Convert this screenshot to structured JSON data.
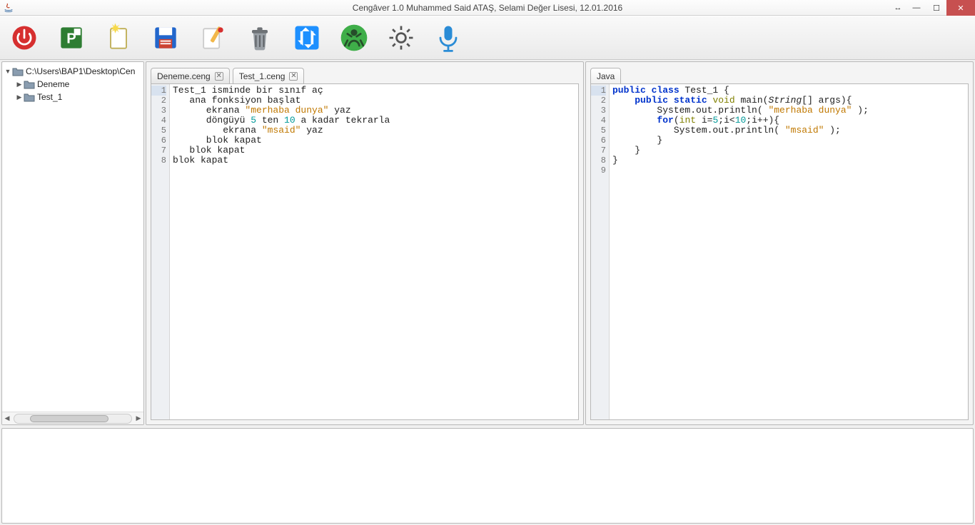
{
  "window": {
    "title": "Cengâver 1.0  Muhammed Said ATAŞ, Selami Değer Lisesi, 12.01.2016"
  },
  "tree": {
    "root": "C:\\Users\\BAP1\\Desktop\\Cen",
    "items": [
      "Deneme",
      "Test_1"
    ]
  },
  "editor": {
    "tabs": [
      {
        "label": "Deneme.ceng",
        "active": false
      },
      {
        "label": "Test_1.ceng",
        "active": true
      }
    ],
    "code": {
      "lines": [
        {
          "n": 1,
          "tokens": [
            {
              "t": "Test_1 isminde bir sınıf aç"
            }
          ]
        },
        {
          "n": 2,
          "tokens": [
            {
              "t": "   ana fonksiyon başlat"
            }
          ]
        },
        {
          "n": 3,
          "tokens": [
            {
              "t": "      ekrana "
            },
            {
              "t": "\"merhaba dunya\"",
              "c": "k-str"
            },
            {
              "t": " yaz"
            }
          ]
        },
        {
          "n": 4,
          "tokens": [
            {
              "t": "      döngüyü "
            },
            {
              "t": "5",
              "c": "k-teal"
            },
            {
              "t": " ten "
            },
            {
              "t": "10",
              "c": "k-teal"
            },
            {
              "t": " a kadar tekrarla"
            }
          ]
        },
        {
          "n": 5,
          "tokens": [
            {
              "t": "         ekrana "
            },
            {
              "t": "\"msaid\"",
              "c": "k-str"
            },
            {
              "t": " yaz"
            }
          ]
        },
        {
          "n": 6,
          "tokens": [
            {
              "t": "      blok kapat"
            }
          ]
        },
        {
          "n": 7,
          "tokens": [
            {
              "t": "   blok kapat"
            }
          ]
        },
        {
          "n": 8,
          "tokens": [
            {
              "t": "blok kapat"
            }
          ]
        }
      ],
      "highlight_line": 1
    }
  },
  "output": {
    "tabs": [
      {
        "label": "Java",
        "active": true
      }
    ],
    "code": {
      "lines": [
        {
          "n": 1,
          "tokens": [
            {
              "t": "public ",
              "c": "k-blue"
            },
            {
              "t": "class ",
              "c": "k-blue"
            },
            {
              "t": "Test_1 {"
            }
          ]
        },
        {
          "n": 2,
          "tokens": [
            {
              "t": "    "
            },
            {
              "t": "public ",
              "c": "k-blue"
            },
            {
              "t": "static ",
              "c": "k-blue"
            },
            {
              "t": "void ",
              "c": "k-olive"
            },
            {
              "t": "main("
            },
            {
              "t": "String",
              "c": "k-em"
            },
            {
              "t": "[] args){"
            }
          ]
        },
        {
          "n": 3,
          "tokens": [
            {
              "t": "        System.out.println( "
            },
            {
              "t": "\"merhaba dunya\"",
              "c": "k-str"
            },
            {
              "t": " );"
            }
          ]
        },
        {
          "n": 4,
          "tokens": [
            {
              "t": "        "
            },
            {
              "t": "for",
              "c": "k-blue"
            },
            {
              "t": "("
            },
            {
              "t": "int ",
              "c": "k-olive"
            },
            {
              "t": "i="
            },
            {
              "t": "5",
              "c": "k-teal"
            },
            {
              "t": ";i<"
            },
            {
              "t": "10",
              "c": "k-teal"
            },
            {
              "t": ";i++){"
            }
          ]
        },
        {
          "n": 5,
          "tokens": [
            {
              "t": "           System.out.println( "
            },
            {
              "t": "\"msaid\"",
              "c": "k-str"
            },
            {
              "t": " );"
            }
          ]
        },
        {
          "n": 6,
          "tokens": [
            {
              "t": "        }"
            }
          ]
        },
        {
          "n": 7,
          "tokens": [
            {
              "t": "    }"
            }
          ]
        },
        {
          "n": 8,
          "tokens": [
            {
              "t": "}"
            }
          ]
        },
        {
          "n": 9,
          "tokens": [
            {
              "t": ""
            }
          ]
        }
      ],
      "highlight_line": 1
    }
  }
}
